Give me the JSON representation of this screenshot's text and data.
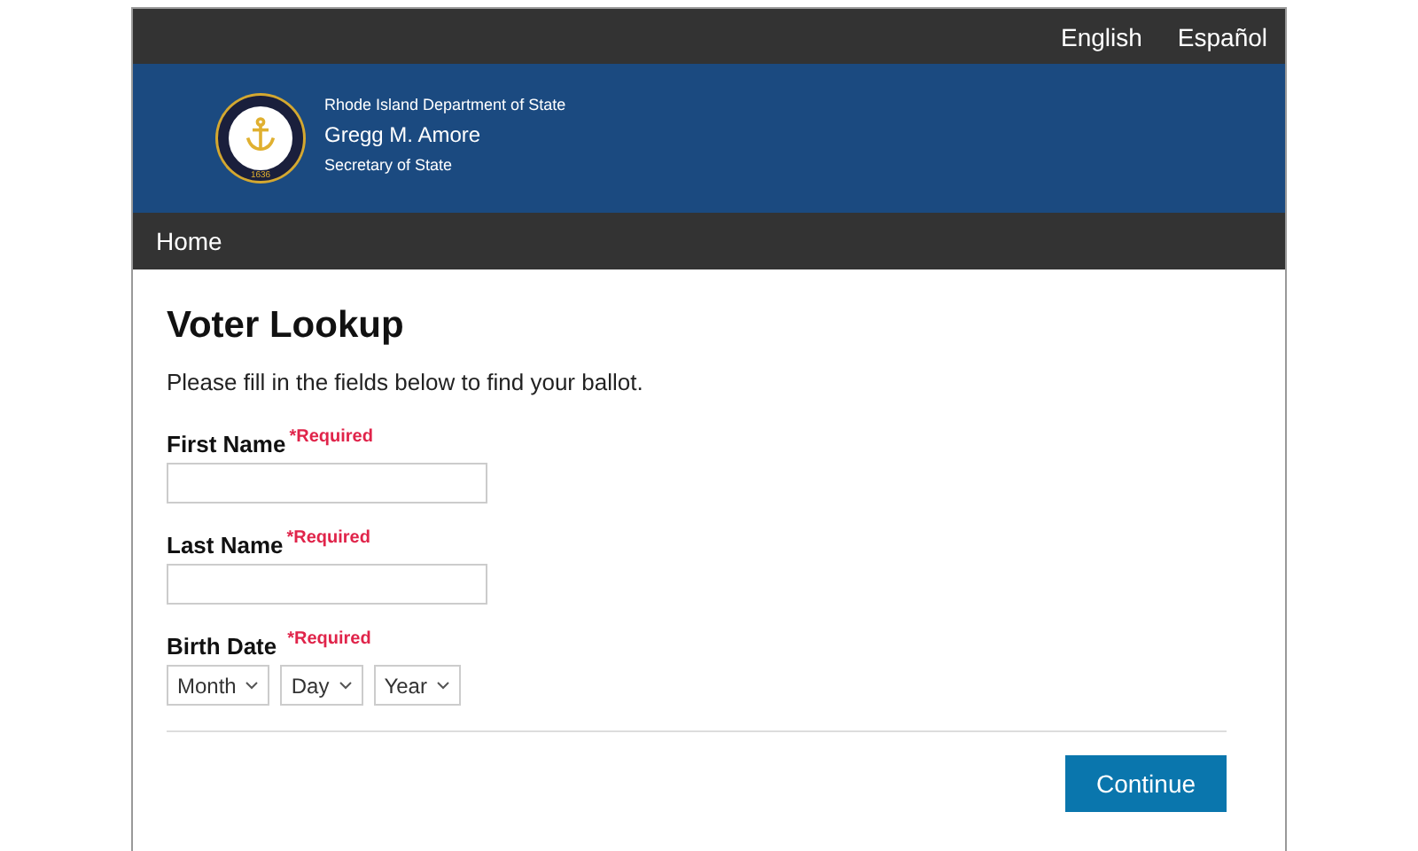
{
  "languages": [
    {
      "label": "English"
    },
    {
      "label": "Español"
    }
  ],
  "header": {
    "seal_year": "1636",
    "department": "Rhode Island Department of State",
    "name": "Gregg M. Amore",
    "role": "Secretary of State"
  },
  "nav": [
    {
      "label": "Home"
    }
  ],
  "page": {
    "title": "Voter Lookup",
    "intro": "Please fill in the fields below to find your ballot."
  },
  "fields": [
    {
      "kind": "text",
      "label": "First Name",
      "required": "*Required"
    },
    {
      "kind": "text",
      "label": "Last Name",
      "required": "*Required"
    },
    {
      "kind": "date",
      "label": "Birth Date",
      "required": "*Required",
      "selects": [
        "Month",
        "Day",
        "Year"
      ]
    }
  ],
  "button": "Continue"
}
